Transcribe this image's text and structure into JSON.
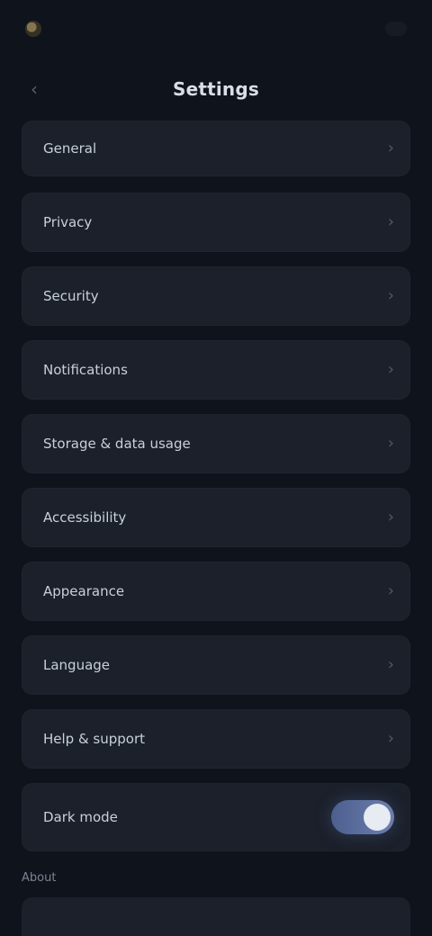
{
  "header": {
    "brand": "",
    "action": ""
  },
  "title": "Settings",
  "settings": [
    {
      "label": "General",
      "type": "chevron"
    },
    {
      "label": "Privacy",
      "type": "chevron"
    },
    {
      "label": "Security",
      "type": "chevron"
    },
    {
      "label": "Notifications",
      "type": "chevron"
    },
    {
      "label": "Storage & data usage",
      "type": "chevron"
    },
    {
      "label": "Accessibility",
      "type": "chevron"
    },
    {
      "label": "Appearance",
      "type": "chevron"
    },
    {
      "label": "Language",
      "type": "chevron"
    },
    {
      "label": "Help & support",
      "type": "chevron"
    },
    {
      "label": "Dark mode",
      "type": "toggle",
      "enabled": true
    }
  ],
  "section": {
    "caption": "About"
  },
  "icons": {
    "brand": "brand-icon",
    "back": "chevron-left-icon",
    "row": "chevron-right-icon",
    "toggle": "toggle-switch-icon"
  },
  "colors": {
    "background": "#0f131b",
    "card": "#1b202a",
    "accent": "#6d7fae"
  }
}
